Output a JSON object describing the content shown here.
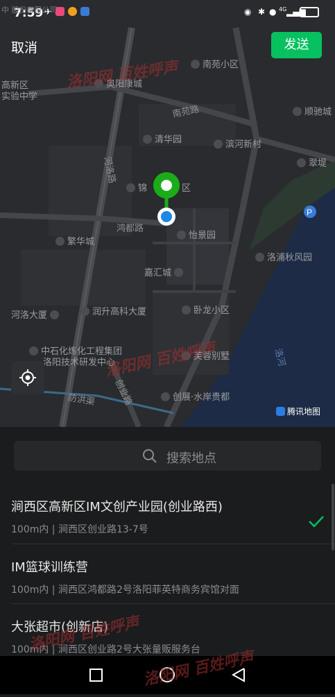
{
  "status_bar": {
    "time": "7:59",
    "signal": "4G",
    "bg_text": "中 股份有限公司"
  },
  "header": {
    "cancel_label": "取消",
    "send_label": "发送"
  },
  "map": {
    "roads": [
      "南苑路",
      "河洛路",
      "鸿都路",
      "创业路",
      "防洪渠",
      "洛河"
    ],
    "pois": [
      "南苑小区",
      "高新区",
      "实验中学",
      "奥阳康城",
      "顺驰城",
      "清华园",
      "滨河新村",
      "翠堤",
      "锦",
      "区",
      "怡景园",
      "繁华城",
      "洛浦秋风园",
      "嘉汇城",
      "河洛大厦",
      "润升高科大厦",
      "卧龙小区",
      "中石化炼化工程集团",
      "洛阳技术研发中心",
      "芙蓉别墅",
      "创展·水岸贵都"
    ],
    "brand": "腾讯地图",
    "watermark": "洛阳网 百姓呼声"
  },
  "search": {
    "placeholder": "搜索地点"
  },
  "results": [
    {
      "title": "涧西区高新区IM文创产业园(创业路西)",
      "subtitle": "100m内 | 涧西区创业路13-7号",
      "selected": true
    },
    {
      "title": "IM篮球训练营",
      "subtitle": "100m内 | 涧西区鸿都路2号洛阳菲英特商务宾馆对面",
      "selected": false
    },
    {
      "title": "大张超市(创新店)",
      "subtitle": "100m内 | 涧西区创业路2号大张量贩服务台",
      "selected": false
    }
  ],
  "colors": {
    "accent": "#07c160",
    "pin_green": "#1aad19",
    "location_blue": "#1e88e5"
  }
}
